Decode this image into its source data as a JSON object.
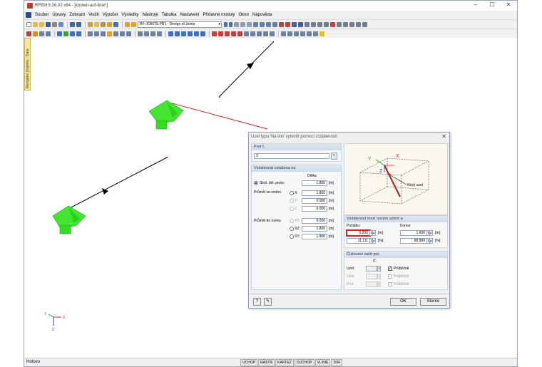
{
  "window": {
    "title": "RFEM 5.26.02 x64 - [knoten-auf-linie*]"
  },
  "menu": [
    "Soubor",
    "Úpravy",
    "Zobrazit",
    "Vložit",
    "Výpočet",
    "Výsledky",
    "Nástroje",
    "Tabulka",
    "Nastavení",
    "Přídavné moduly",
    "Okno",
    "Nápověda"
  ],
  "toolbar": {
    "module_combo": "RF-JOINTS PŘ1 - Design of Joints"
  },
  "navigator": {
    "tab": "Navigátor projektu - Data"
  },
  "status": {
    "ready": "Hotovo",
    "buttons": [
      "UCHOP",
      "RASTR",
      "KARTEZ",
      "OUCHOP",
      "VLINIE",
      "DXF"
    ]
  },
  "dialog": {
    "title": "Uzel typu 'Na linii' vytvořit pomocí vzdálenosti",
    "prut_header": "Prut č.",
    "prut_value": "3",
    "vzdal_header": "Vzdálenost vztažena na",
    "delka_col": "Délka",
    "skut_label": "Skut. dél. prutu:",
    "skut_value": "1.800",
    "smeru_label": "Průmět ve směru",
    "roviny_label": "Průmět do roviny",
    "unit_m": "[m]",
    "unit_pct": "[%]",
    "smer": [
      {
        "axis": "X:",
        "value": "1.800",
        "active": true
      },
      {
        "axis": "Y:",
        "value": "0.000",
        "active": false
      },
      {
        "axis": "Z:",
        "value": "0.000",
        "active": false
      }
    ],
    "roviny": [
      {
        "axis": "YZ:",
        "value": "0.000",
        "active": false
      },
      {
        "axis": "XZ:",
        "value": "1.800",
        "active": true
      },
      {
        "axis": "XY:",
        "value": "1.800",
        "active": true
      }
    ],
    "diagram_label": "Nový uzel",
    "diagram_axes": {
      "x": "X",
      "y": "Y",
      "z": "Z"
    },
    "mezi_header": "Vzdálenost mezi novým uzlem a",
    "pocatek_label": "Počátku:",
    "konec_label": "Konce:",
    "pocatek_m": "0.200",
    "pocatek_pct": "11.111",
    "konec_m": "1.600",
    "konec_pct": "88.889",
    "cisl_header": "Číslování začít pro",
    "c_col": "Č.",
    "cisl": [
      {
        "label": "Uzel:",
        "value": "",
        "active": true
      },
      {
        "label": "Linie:",
        "value": "",
        "active": false
      },
      {
        "label": "Prut:",
        "value": "",
        "active": false
      }
    ],
    "prubezne": "Průběžně",
    "ok": "OK",
    "storno": "Storno"
  },
  "colors": {
    "accent_red": "#d42020",
    "support_green": "#33dd22",
    "axis_x": "#e02020",
    "axis_y": "#20a020",
    "axis_z": "#2040e0"
  }
}
